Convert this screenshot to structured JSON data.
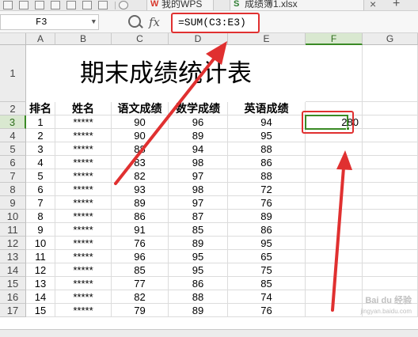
{
  "tabs": [
    {
      "label": "我的WPS",
      "icon": "wps-logo-icon",
      "icon_glyph": "W",
      "icon_color": "#d9372b"
    },
    {
      "label": "成绩簿1.xlsx",
      "icon": "spreadsheet-icon",
      "icon_glyph": "S",
      "icon_color": "#2e7d32"
    }
  ],
  "window_controls": {
    "add": "+"
  },
  "formula_bar": {
    "name_box": "F3",
    "fx": "fx",
    "formula": "=SUM(C3:E3)"
  },
  "columns": [
    "A",
    "B",
    "C",
    "D",
    "E",
    "F",
    "G"
  ],
  "active_column": "F",
  "active_row": 3,
  "title": "期末成绩统计表",
  "header_row": [
    "排名",
    "姓名",
    "语文成绩",
    "数学成绩",
    "英语成绩"
  ],
  "rows": [
    {
      "row": 3,
      "cells": [
        "1",
        "*****",
        "90",
        "96",
        "94"
      ],
      "f": "280"
    },
    {
      "row": 4,
      "cells": [
        "2",
        "*****",
        "90",
        "89",
        "95"
      ]
    },
    {
      "row": 5,
      "cells": [
        "3",
        "*****",
        "88",
        "94",
        "88"
      ]
    },
    {
      "row": 6,
      "cells": [
        "4",
        "*****",
        "83",
        "98",
        "86"
      ]
    },
    {
      "row": 7,
      "cells": [
        "5",
        "*****",
        "82",
        "97",
        "88"
      ]
    },
    {
      "row": 8,
      "cells": [
        "6",
        "*****",
        "93",
        "98",
        "72"
      ]
    },
    {
      "row": 9,
      "cells": [
        "7",
        "*****",
        "89",
        "97",
        "76"
      ]
    },
    {
      "row": 10,
      "cells": [
        "8",
        "*****",
        "86",
        "87",
        "89"
      ]
    },
    {
      "row": 11,
      "cells": [
        "9",
        "*****",
        "91",
        "85",
        "86"
      ]
    },
    {
      "row": 12,
      "cells": [
        "10",
        "*****",
        "76",
        "89",
        "95"
      ]
    },
    {
      "row": 13,
      "cells": [
        "11",
        "*****",
        "96",
        "95",
        "65"
      ]
    },
    {
      "row": 14,
      "cells": [
        "12",
        "*****",
        "85",
        "95",
        "75"
      ]
    },
    {
      "row": 15,
      "cells": [
        "13",
        "*****",
        "77",
        "86",
        "85"
      ]
    },
    {
      "row": 16,
      "cells": [
        "14",
        "*****",
        "82",
        "88",
        "74"
      ]
    },
    {
      "row": 17,
      "cells": [
        "15",
        "*****",
        "79",
        "89",
        "76"
      ]
    }
  ],
  "watermark": {
    "line1": "Bai du 经验",
    "line2": "jingyan.baidu.com"
  },
  "colors": {
    "selection": "#3a8a25",
    "highlight": "#e03030"
  }
}
